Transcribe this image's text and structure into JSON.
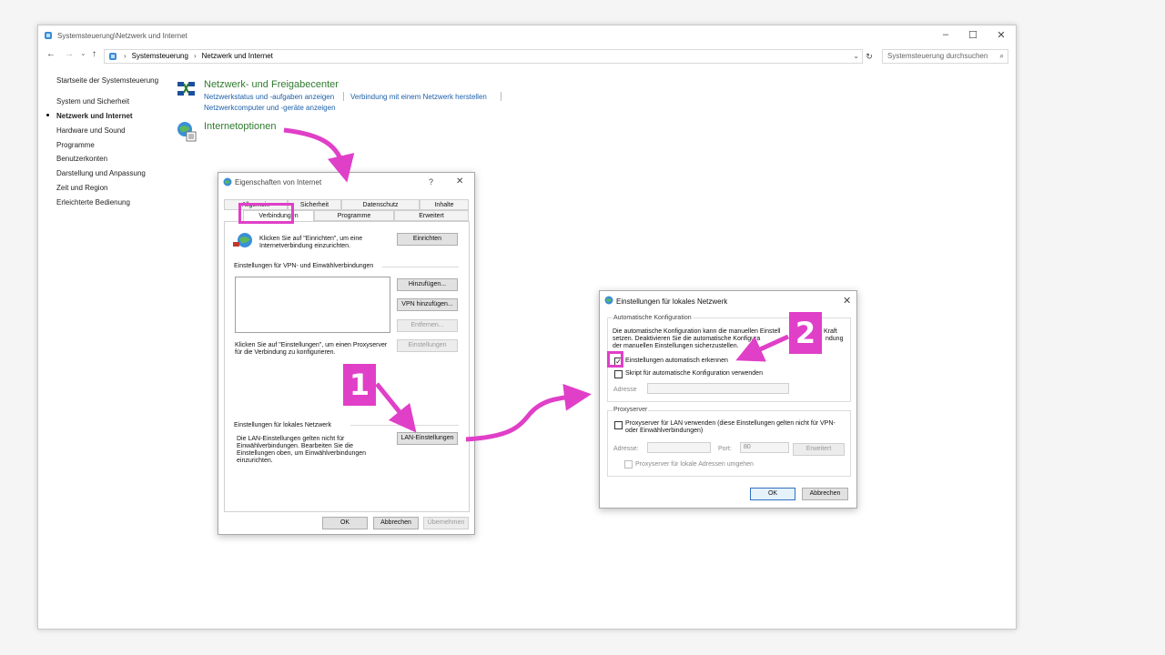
{
  "window": {
    "title": "Systemsteuerung\\Netzwerk und Internet",
    "controls": [
      "–",
      "☐",
      "✕"
    ]
  },
  "nav": {
    "back": "←",
    "forward": "→",
    "dropdown": "⌄",
    "up": "↑",
    "breadcrumbs": [
      "Systemsteuerung",
      "Netzwerk und Internet"
    ],
    "separator": "›",
    "address_dropdown": "⌄",
    "refresh": "↻",
    "search_placeholder": "Systemsteuerung durchsuchen",
    "search_icon": "⌕"
  },
  "sidebar": {
    "items": [
      {
        "label": "Startseite der Systemsteuerung"
      },
      {
        "label": "System und Sicherheit"
      },
      {
        "label": "Netzwerk und Internet",
        "active": true
      },
      {
        "label": "Hardware und Sound"
      },
      {
        "label": "Programme"
      },
      {
        "label": "Benutzerkonten"
      },
      {
        "label": "Darstellung und Anpassung"
      },
      {
        "label": "Zeit und Region"
      },
      {
        "label": "Erleichterte Bedienung"
      }
    ]
  },
  "main": {
    "network_center": {
      "title": "Netzwerk- und Freigabecenter",
      "links": [
        "Netzwerkstatus und -aufgaben anzeigen",
        "Verbindung mit einem Netzwerk herstellen",
        "Netzwerkcomputer und -geräte anzeigen"
      ]
    },
    "internet_options": {
      "title": "Internetoptionen"
    }
  },
  "inet_dialog": {
    "title": "Eigenschaften von Internet",
    "help": "?",
    "close": "✕",
    "tabs_back": [
      "Allgemein",
      "Sicherheit",
      "Datenschutz",
      "Inhalte"
    ],
    "tabs_front": [
      "Verbindungen",
      "Programme",
      "Erweitert"
    ],
    "setup_text": "Klicken Sie auf \"Einrichten\", um eine Internetverbindung einzurichten.",
    "setup_button": "Einrichten",
    "vpn_section": "Einstellungen für VPN- und Einwählverbindungen",
    "add_button": "Hinzufügen...",
    "add_vpn_button": "VPN hinzufügen...",
    "remove_button": "Entfernen...",
    "settings_button": "Einstellungen",
    "proxy_text": "Klicken Sie auf \"Einstellungen\", um einen Proxyserver für die Verbindung zu konfigurieren.",
    "lan_section": "Einstellungen für lokales Netzwerk",
    "lan_text": "Die LAN-Einstellungen gelten nicht für Einwählverbindungen. Bearbeiten Sie die Einstellungen oben, um Einwählverbindungen einzurichten.",
    "lan_button": "LAN-Einstellungen",
    "ok": "OK",
    "cancel": "Abbrechen",
    "apply": "Übernehmen"
  },
  "lan_dialog": {
    "title": "Einstellungen für lokales Netzwerk",
    "close": "✕",
    "auto_group": "Automatische Konfiguration",
    "auto_text": "Die automatische Konfiguration kann die manuellen Einstell... Kraft setzen. Deaktivieren Sie die automatische Konfigura... ...endung der manuellen Einstellungen sicherzustellen.",
    "auto_text_lines": [
      "Die automatische Konfiguration kann die manuellen Einstell",
      "setzen. Deaktivieren Sie die automatische Konfigura",
      "der manuellen Einstellungen sicherzustellen."
    ],
    "auto_text_tail": [
      "Kraft",
      "ndung"
    ],
    "detect_label": "Einstellungen automatisch erkennen",
    "detect_checked": true,
    "script_label": "Skript für automatische Konfiguration verwenden",
    "script_checked": false,
    "address_label": "Adresse",
    "proxy_group": "Proxyserver",
    "proxy_label": "Proxyserver für LAN verwenden (diese Einstellungen gelten nicht für VPN- oder Einwählverbindungen)",
    "proxy_address_label": "Adresse:",
    "port_label": "Port:",
    "port_value": "80",
    "advanced_button": "Erweitert",
    "bypass_label": "Proxyserver für lokale Adressen umgehen",
    "ok": "OK",
    "cancel": "Abbrechen"
  },
  "annotations": {
    "step1": "1",
    "step2": "2",
    "color": "#e03fc8"
  }
}
